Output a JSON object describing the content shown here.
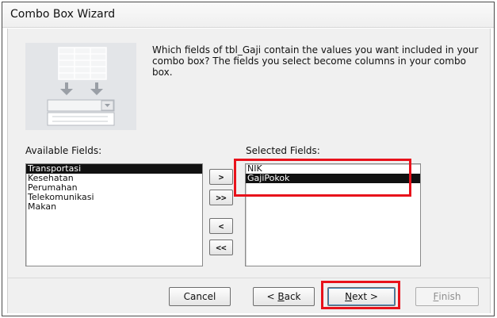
{
  "window": {
    "title": "Combo Box Wizard"
  },
  "instruction": "Which fields of tbl_Gaji contain the values you want included in your combo box? The fields you select become columns in your combo box.",
  "available": {
    "label": "Available Fields:",
    "items": [
      "Transportasi",
      "Kesehatan",
      "Perumahan",
      "Telekomunikasi",
      "Makan"
    ],
    "selected_index": 0
  },
  "selected": {
    "label": "Selected Fields:",
    "items": [
      "NIK",
      "GajiPokok"
    ],
    "selected_index": 1
  },
  "move_buttons": {
    "add_one": ">",
    "add_all": ">>",
    "remove_one": "<",
    "remove_all": "<<"
  },
  "footer": {
    "cancel": "Cancel",
    "back_mnemonic": "B",
    "back_rest": "ack",
    "back_prefix": "< ",
    "next_mnemonic": "N",
    "next_rest": "ext >",
    "finish_mnemonic": "F",
    "finish_rest": "inish"
  },
  "colors": {
    "highlight_box": "#e8121b",
    "selection": "#111111"
  }
}
